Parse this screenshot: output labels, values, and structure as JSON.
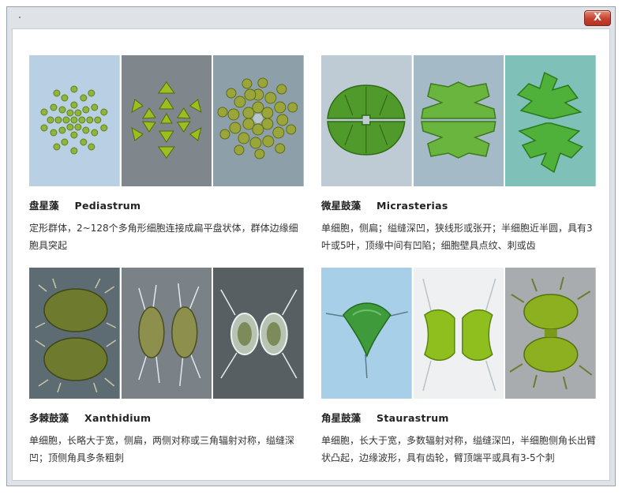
{
  "window": {
    "close_label": "X",
    "close_color": "#c4412d"
  },
  "cards": [
    {
      "name_cn": "盘星藻",
      "name_latin": "Pediastrum",
      "description": "定形群体，2~128个多角形细胞连接成扁平盘状体，群体边缘细胞具突起",
      "image_backgrounds": [
        "#b8cfe4",
        "#7f868c",
        "#8d9fa9"
      ]
    },
    {
      "name_cn": "微星鼓藻",
      "name_latin": "Micrasterias",
      "description": "单细胞，侧扁；缢缝深凹，狭线形或张开；半细胞近半圆，具有3叶或5叶，顶缘中间有凹陷；细胞壁具点纹、刺或齿",
      "image_backgrounds": [
        "#bfcbd4",
        "#a4bac6",
        "#7fc0b8"
      ]
    },
    {
      "name_cn": "多棘鼓藻",
      "name_latin": "Xanthidium",
      "description": "单细胞，长略大于宽，侧扁，两侧对称或三角辐射对称，缢缝深凹；顶侧角具多条粗刺",
      "image_backgrounds": [
        "#5d6b72",
        "#7a8287",
        "#585f62"
      ]
    },
    {
      "name_cn": "角星鼓藻",
      "name_latin": "Staurastrum",
      "description": "单细胞，长大于宽，多数辐射对称，缢缝深凹，半细胞侧角长出臂状凸起，边缘波形，具有齿轮，臂顶端平或具有3-5个刺",
      "image_backgrounds": [
        "#a8cfe8",
        "#eef0f1",
        "#a9acae"
      ]
    }
  ]
}
